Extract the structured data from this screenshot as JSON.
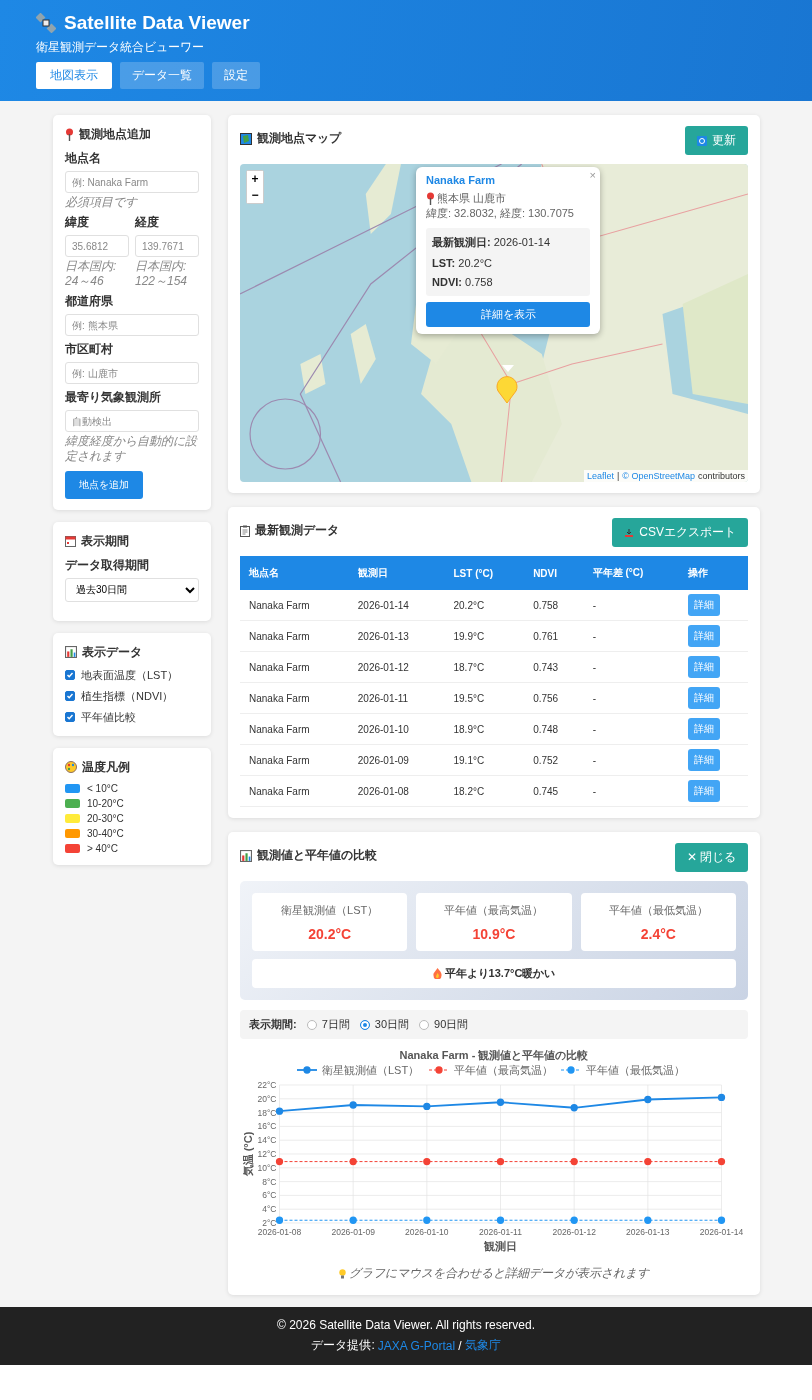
{
  "header": {
    "title": "Satellite Data Viewer",
    "subtitle": "衛星観測データ統合ビューワー",
    "nav": [
      {
        "label": "地図表示",
        "selected": true
      },
      {
        "label": "データ一覧",
        "selected": false
      },
      {
        "label": "設定",
        "selected": false
      }
    ]
  },
  "sidebar": {
    "add_location": {
      "title": "観測地点追加",
      "name_field": {
        "label": "地点名",
        "placeholder": "例: Nanaka Farm",
        "hint": "必須項目です"
      },
      "latitude": {
        "label": "緯度",
        "placeholder": "35.6812",
        "hint": "日本国内: 24～46"
      },
      "longitude": {
        "label": "経度",
        "placeholder": "139.7671",
        "hint": "日本国内: 122～154"
      },
      "prefecture": {
        "label": "都道府県",
        "placeholder": "例: 熊本県"
      },
      "city": {
        "label": "市区町村",
        "placeholder": "例: 山鹿市"
      },
      "station": {
        "label": "最寄り気象観測所",
        "placeholder": "自動検出",
        "hint": "緯度経度から自動的に設定されます"
      },
      "button": "地点を追加"
    },
    "period": {
      "title": "表示期間",
      "label": "データ取得期間",
      "value": "過去30日間"
    },
    "display_data": {
      "title": "表示データ",
      "options": [
        {
          "label": "地表面温度（LST）",
          "checked": true
        },
        {
          "label": "植生指標（NDVI）",
          "checked": true
        },
        {
          "label": "平年値比較",
          "checked": true
        }
      ]
    },
    "legend": {
      "title": "温度凡例",
      "items": [
        {
          "label": "< 10°C",
          "color": "#2196f3"
        },
        {
          "label": "10-20°C",
          "color": "#4caf50"
        },
        {
          "label": "20-30°C",
          "color": "#ffeb3b"
        },
        {
          "label": "30-40°C",
          "color": "#ff9800"
        },
        {
          "label": "> 40°C",
          "color": "#f44336"
        }
      ]
    }
  },
  "map_card": {
    "title": "観測地点マップ",
    "button": "更新",
    "zoom_in": "+",
    "zoom_out": "−",
    "attribution": {
      "link1": "Leaflet",
      "separator": "|",
      "link2": "© OpenStreetMap",
      "text": "contributors"
    },
    "popup": {
      "title": "Nanaka Farm",
      "close": "×",
      "location": "熊本県 山鹿市",
      "coords": "緯度: 32.8032, 経度: 130.7075",
      "details": [
        "**最新観測日:** 2026-01-14",
        "**LST:** 20.2°C",
        "**NDVI:** 0.758"
      ],
      "button": "詳細を表示"
    }
  },
  "latest_data": {
    "title": "最新観測データ",
    "button": "CSVエクスポート",
    "columns": [
      "地点名",
      "観測日",
      "LST (°C)",
      "NDVI",
      "平年差 (°C)",
      "操作"
    ],
    "rows": [
      {
        "cells": [
          "Nanaka Farm",
          "2026-01-14",
          "20.2°C",
          "0.758",
          "-"
        ],
        "action": "詳細"
      },
      {
        "cells": [
          "Nanaka Farm",
          "2026-01-13",
          "19.9°C",
          "0.761",
          "-"
        ],
        "action": "詳細"
      },
      {
        "cells": [
          "Nanaka Farm",
          "2026-01-12",
          "18.7°C",
          "0.743",
          "-"
        ],
        "action": "詳細"
      },
      {
        "cells": [
          "Nanaka Farm",
          "2026-01-11",
          "19.5°C",
          "0.756",
          "-"
        ],
        "action": "詳細"
      },
      {
        "cells": [
          "Nanaka Farm",
          "2026-01-10",
          "18.9°C",
          "0.748",
          "-"
        ],
        "action": "詳細"
      },
      {
        "cells": [
          "Nanaka Farm",
          "2026-01-09",
          "19.1°C",
          "0.752",
          "-"
        ],
        "action": "詳細"
      },
      {
        "cells": [
          "Nanaka Farm",
          "2026-01-08",
          "18.2°C",
          "0.745",
          "-"
        ],
        "action": "詳細"
      }
    ]
  },
  "comparison": {
    "title": "観測値と平年値の比較",
    "button": "✕ 閉じる",
    "stats": [
      {
        "label": "衛星観測値（LST）",
        "value": "20.2°C"
      },
      {
        "label": "平年値（最高気温）",
        "value": "10.9°C"
      },
      {
        "label": "平年値（最低気温）",
        "value": "2.4°C"
      }
    ],
    "summary": "平年より13.7°C暖かい",
    "period": {
      "label": "表示期間:",
      "options": [
        {
          "label": "7日間",
          "selected": false
        },
        {
          "label": "30日間",
          "selected": true
        },
        {
          "label": "90日間",
          "selected": false
        }
      ]
    },
    "chart_data": {
      "type": "line",
      "title": "Nanaka Farm - 観測値と平年値の比較",
      "xlabel": "観測日",
      "ylabel": "気温 (°C)",
      "categories": [
        "2026-01-08",
        "2026-01-09",
        "2026-01-10",
        "2026-01-11",
        "2026-01-12",
        "2026-01-13",
        "2026-01-14"
      ],
      "series": [
        {
          "name": "衛星観測値（LST）",
          "color": "#1e88e5",
          "line_style": "solid",
          "marker": "circle",
          "values": [
            18.2,
            19.1,
            18.9,
            19.5,
            18.7,
            19.9,
            20.2
          ]
        },
        {
          "name": "平年値（最高気温）",
          "color": "#f44336",
          "line_style": "dashed",
          "marker": "circle",
          "values": [
            10.9,
            10.9,
            10.9,
            10.9,
            10.9,
            10.9,
            10.9
          ]
        },
        {
          "name": "平年値（最低気温）",
          "color": "#2196f3",
          "line_style": "dashed",
          "marker": "circle",
          "values": [
            2.4,
            2.4,
            2.4,
            2.4,
            2.4,
            2.4,
            2.4
          ]
        }
      ],
      "grid": true,
      "legend": "top",
      "ylim": [
        2,
        22
      ],
      "yticks": [
        {
          "value": 2,
          "label": "2°C"
        },
        {
          "value": 4,
          "label": "4°C"
        },
        {
          "value": 6,
          "label": "6°C"
        },
        {
          "value": 8,
          "label": "8°C"
        },
        {
          "value": 10,
          "label": "10°C"
        },
        {
          "value": 12,
          "label": "12°C"
        },
        {
          "value": 14,
          "label": "14°C"
        },
        {
          "value": 16,
          "label": "16°C"
        },
        {
          "value": 18,
          "label": "18°C"
        },
        {
          "value": 20,
          "label": "20°C"
        },
        {
          "value": 22,
          "label": "22°C"
        }
      ]
    },
    "hint": "グラフにマウスを合わせると詳細データが表示されます"
  },
  "footer": {
    "copyright": "© 2026 Satellite Data Viewer. All rights reserved.",
    "source_label": "データ提供:",
    "link1": "JAXA G-Portal",
    "separator": "/",
    "link2": "気象庁"
  }
}
